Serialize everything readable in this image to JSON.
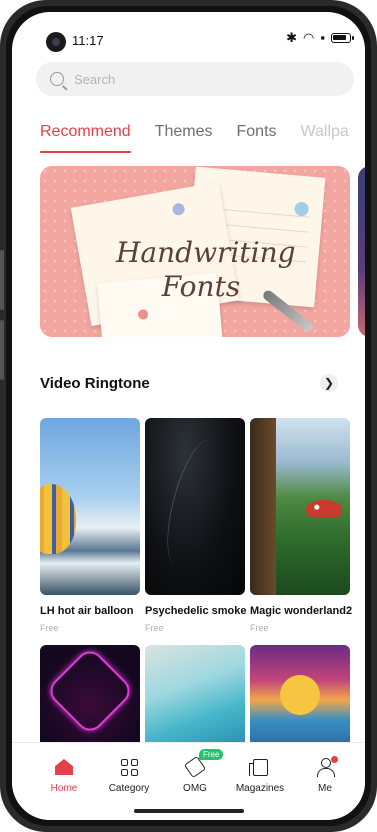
{
  "status_bar": {
    "time": "11:17"
  },
  "search": {
    "placeholder": "Search"
  },
  "tabs": [
    {
      "label": "Recommend",
      "active": true
    },
    {
      "label": "Themes"
    },
    {
      "label": "Fonts"
    },
    {
      "label": "Wallpa"
    }
  ],
  "banner": {
    "title_line1": "Handwriting",
    "title_line2": "Fonts"
  },
  "section": {
    "title": "Video Ringtone"
  },
  "cards": [
    {
      "title": "LH hot air balloon",
      "price": "Free"
    },
    {
      "title": "Psychedelic smoke",
      "price": "Free"
    },
    {
      "title": "Magic wonderland2",
      "price": "Free"
    }
  ],
  "nav": {
    "items": [
      {
        "label": "Home",
        "active": true
      },
      {
        "label": "Category"
      },
      {
        "label": "OMG",
        "badge": "Free"
      },
      {
        "label": "Magazines"
      },
      {
        "label": "Me"
      }
    ]
  },
  "colors": {
    "accent": "#e53f4a",
    "free_badge": "#23c46b"
  }
}
